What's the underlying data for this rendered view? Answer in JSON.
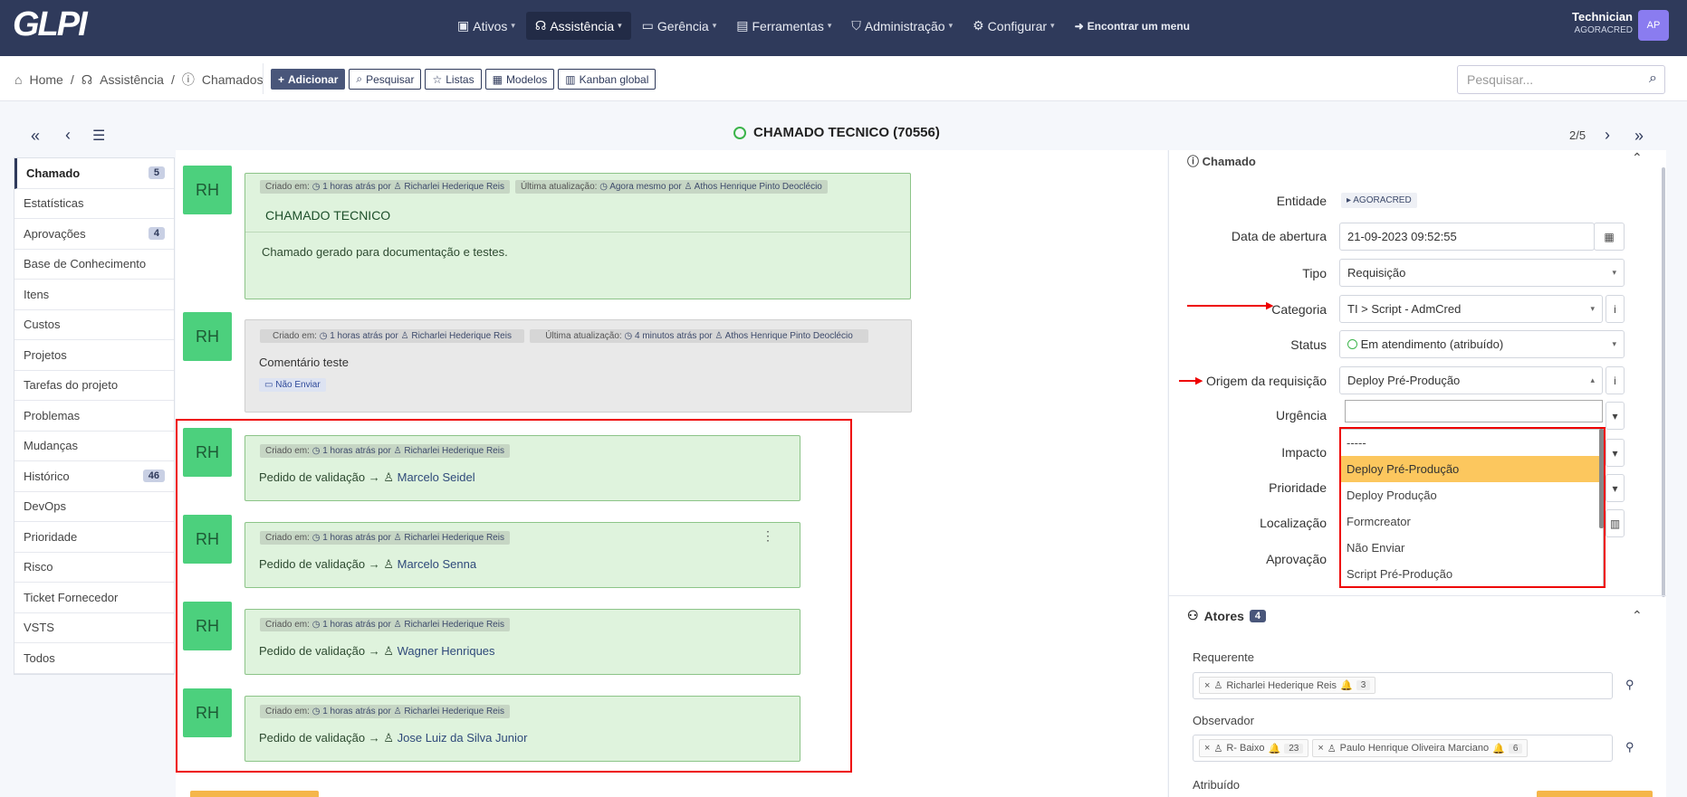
{
  "app": {
    "logo": "GLPI",
    "user_name": "Technician",
    "user_entity": "AGORACRED",
    "user_initials": "AP"
  },
  "menu": [
    {
      "label": "Ativos",
      "icon": "box-icon"
    },
    {
      "label": "Assistência",
      "icon": "headset-icon",
      "active": true
    },
    {
      "label": "Gerência",
      "icon": "wallet-icon"
    },
    {
      "label": "Ferramentas",
      "icon": "briefcase-icon"
    },
    {
      "label": "Administração",
      "icon": "shield-icon"
    },
    {
      "label": "Configurar",
      "icon": "gear-icon"
    }
  ],
  "menu_find": "Encontrar um menu",
  "breadcrumb": {
    "home": "Home",
    "assist": "Assistência",
    "tickets": "Chamados"
  },
  "actions": {
    "add": "Adicionar",
    "search": "Pesquisar",
    "lists": "Listas",
    "models": "Modelos",
    "kanban": "Kanban global"
  },
  "search_placeholder": "Pesquisar...",
  "ticket": {
    "title": "CHAMADO TECNICO (70556)",
    "pager": "2/5"
  },
  "sidebar": [
    {
      "label": "Chamado",
      "badge": "5",
      "active": true
    },
    {
      "label": "Estatísticas"
    },
    {
      "label": "Aprovações",
      "badge": "4"
    },
    {
      "label": "Base de Conhecimento"
    },
    {
      "label": "Itens"
    },
    {
      "label": "Custos"
    },
    {
      "label": "Projetos"
    },
    {
      "label": "Tarefas do projeto"
    },
    {
      "label": "Problemas"
    },
    {
      "label": "Mudanças"
    },
    {
      "label": "Histórico",
      "badge": "46"
    },
    {
      "label": "DevOps"
    },
    {
      "label": "Prioridade"
    },
    {
      "label": "Risco"
    },
    {
      "label": "Ticket Fornecedor"
    },
    {
      "label": "VSTS"
    },
    {
      "label": "Todos"
    }
  ],
  "timeline": {
    "avatar": "RH",
    "main": {
      "created_label": "Criado em:",
      "created": "1 horas atrás por",
      "author": "Richarlei Hederique Reis",
      "updated_label": "Última atualização:",
      "updated": "Agora mesmo por",
      "updater": "Athos Henrique Pinto Deoclécio",
      "title": "CHAMADO TECNICO",
      "body": "Chamado gerado para documentação e testes."
    },
    "comment": {
      "created_label": "Criado em:",
      "created": "1 horas atrás por",
      "author": "Richarlei Hederique Reis",
      "updated_label": "Última atualização:",
      "updated": "4 minutos atrás por",
      "updater": "Athos Henrique Pinto Deoclécio",
      "body": "Comentário teste",
      "tag": "Não Enviar"
    },
    "validations": [
      {
        "created_label": "Criado em:",
        "created": "1 horas atrás por",
        "author": "Richarlei Hederique Reis",
        "text": "Pedido de validação",
        "target": "Marcelo Seidel"
      },
      {
        "created_label": "Criado em:",
        "created": "1 horas atrás por",
        "author": "Richarlei Hederique Reis",
        "text": "Pedido de validação",
        "target": "Marcelo Senna"
      },
      {
        "created_label": "Criado em:",
        "created": "1 horas atrás por",
        "author": "Richarlei Hederique Reis",
        "text": "Pedido de validação",
        "target": "Wagner Henriques"
      },
      {
        "created_label": "Criado em:",
        "created": "1 horas atrás por",
        "author": "Richarlei Hederique Reis",
        "text": "Pedido de validação",
        "target": "Jose Luiz da Silva Junior"
      }
    ]
  },
  "form": {
    "section": "Chamado",
    "entidade_label": "Entidade",
    "entidade": "AGORACRED",
    "data_label": "Data de abertura",
    "data": "21-09-2023 09:52:55",
    "tipo_label": "Tipo",
    "tipo": "Requisição",
    "categoria_label": "Categoria",
    "categoria": "TI > Script - AdmCred",
    "status_label": "Status",
    "status": "Em atendimento (atribuído)",
    "origem_label": "Origem da requisição",
    "origem": "Deploy Pré-Produção",
    "urgencia_label": "Urgência",
    "impacto_label": "Impacto",
    "prioridade_label": "Prioridade",
    "localizacao_label": "Localização",
    "aprovacao_label": "Aprovação"
  },
  "dropdown_options": [
    "-----",
    "Deploy Pré-Produção",
    "Deploy Produção",
    "Formcreator",
    "Não Enviar",
    "Script Pré-Produção"
  ],
  "actors": {
    "title": "Atores",
    "count": "4",
    "requerente_label": "Requerente",
    "requerente": "Richarlei Hederique Reis",
    "requerente_count": "3",
    "observador_label": "Observador",
    "observador1": "R- Baixo",
    "observador1_count": "23",
    "observador2": "Paulo Henrique Oliveira Marciano",
    "observador2_count": "6",
    "atribuido_label": "Atribuído"
  },
  "colors": {
    "nav": "#2f3a5b",
    "highlight": "#e00000",
    "selected": "#fcc75e",
    "card": "#dff3dd"
  }
}
